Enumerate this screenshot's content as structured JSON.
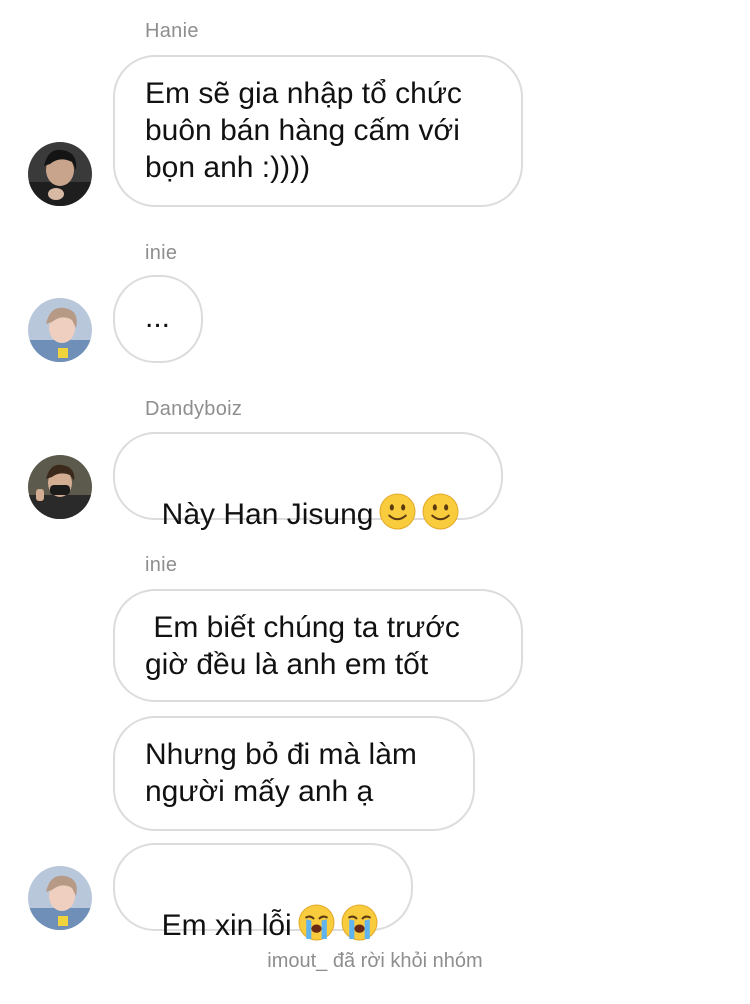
{
  "messages": [
    {
      "sender": "Hanie",
      "text": "Em sẽ gia nhập tổ chức\nbuôn bán hàng cấm với\nbọn anh :))))"
    },
    {
      "sender": "inie",
      "text": "..."
    },
    {
      "sender": "Dandyboiz",
      "text": "Này Han Jisung",
      "emojis": [
        "slightly-smiling-face",
        "slightly-smiling-face"
      ]
    },
    {
      "sender": "inie",
      "text": " Em biết chúng ta trước\ngiờ đều là anh em tốt"
    },
    {
      "text": "Nhưng bỏ đi mà làm\nngười mấy anh ạ"
    },
    {
      "text": "Em xin lỗi",
      "emojis": [
        "loudly-crying-face",
        "loudly-crying-face"
      ]
    }
  ],
  "system_notice": "imout_ đã rời khỏi nhóm",
  "colors": {
    "bubble_border": "#dcdcdc",
    "meta_text": "#8e8e8e",
    "message_text": "#111111"
  }
}
